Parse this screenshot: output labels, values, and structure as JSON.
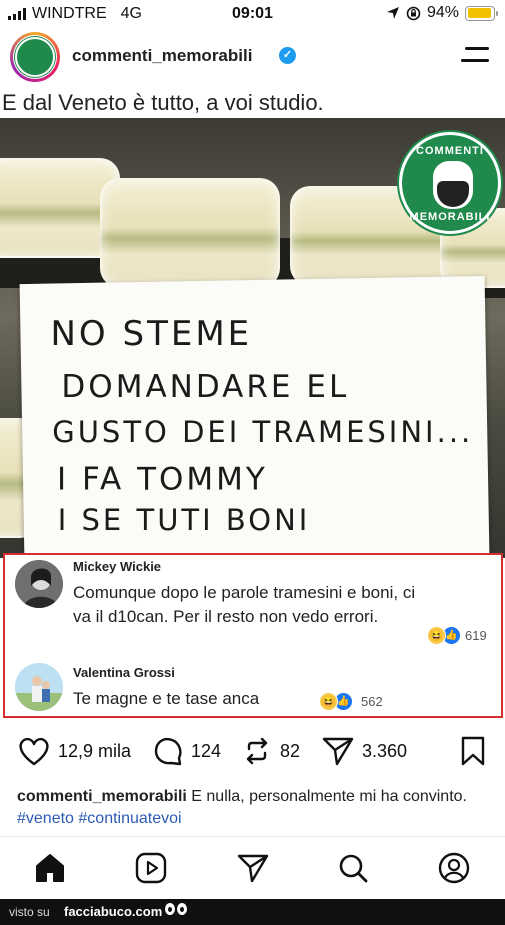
{
  "status_bar": {
    "carrier": "WINDTRE",
    "network": "4G",
    "time": "09:01",
    "battery": "94%",
    "battery_level": 0.94,
    "battery_color": "#f2c200"
  },
  "header": {
    "username": "commenti_memorabili",
    "verified_icon": "verified-check-icon",
    "menu_icon": "hamburger-menu-icon"
  },
  "post": {
    "title": "E dal Veneto è tutto, a voi studio.",
    "sign_lines": [
      "NO STEME",
      "DOMANDARE   EL",
      "GUSTO DEI TRAMESINI...",
      "I FA TOMMY",
      "I SE TUTI    BONI"
    ],
    "badge_top": "COMMENTI",
    "badge_bottom": "MEMORABILI",
    "accent_color": "#1f8a4c"
  },
  "comments": [
    {
      "name": "Mickey Wickie",
      "text": "Comunque dopo le parole tramesini e boni, ci va il d10can. Per il resto non vedo errori.",
      "reaction_count": "619"
    },
    {
      "name": "Valentina Grossi",
      "text": "Te magne e te tase anca",
      "reaction_count": "562"
    }
  ],
  "actions": {
    "likes": "12,9 mila",
    "comments": "124",
    "reposts": "82",
    "shares": "3.360"
  },
  "caption": {
    "username": "commenti_memorabili",
    "text": " E nulla, personalmente mi ha convinto. ",
    "hashtags": [
      "#veneto",
      "#continuatevoi"
    ]
  },
  "nav": {
    "items": [
      "home-icon",
      "reels-icon",
      "send-icon",
      "search-icon",
      "profile-icon"
    ]
  },
  "footer": {
    "prefix": "visto su",
    "site": "facciabuco.com"
  }
}
